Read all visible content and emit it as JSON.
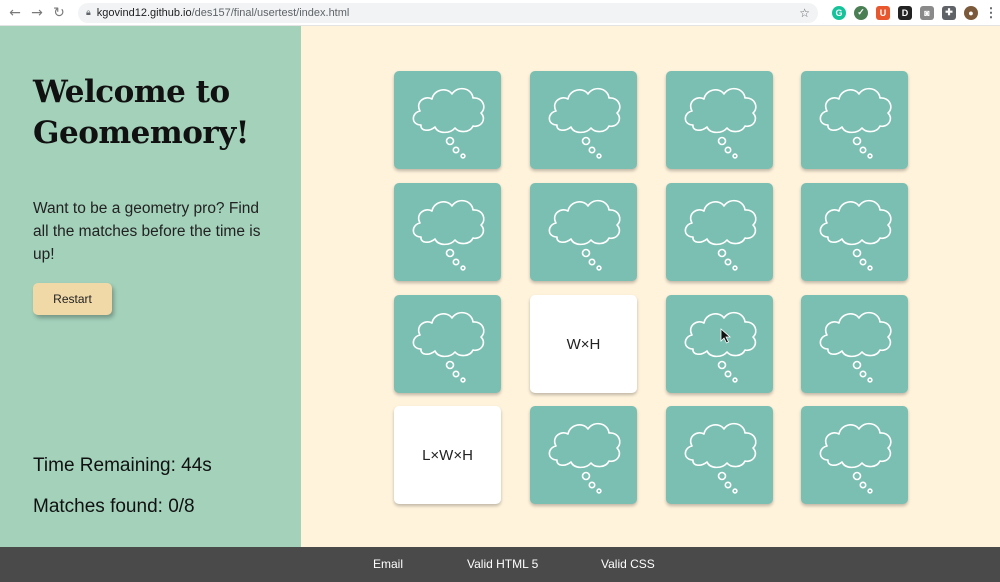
{
  "browser": {
    "url_host": "kgovind12.github.io",
    "url_path": "/des157/final/usertest/index.html",
    "extensions": [
      {
        "name": "grammarly",
        "letter": "G",
        "color": "#15c39a"
      },
      {
        "name": "check",
        "letter": "✓",
        "color": "#4a7f54"
      },
      {
        "name": "brave",
        "letter": "U",
        "color": "#e8572d"
      },
      {
        "name": "doc",
        "letter": "D",
        "color": "#222222"
      },
      {
        "name": "camera",
        "letter": "◙",
        "color": "#8a8a8a"
      },
      {
        "name": "puzzle",
        "letter": "✚",
        "color": "#5f6368"
      },
      {
        "name": "avatar",
        "letter": "●",
        "color": "#7a5a3a"
      }
    ]
  },
  "sidebar": {
    "title": "Welcome to Geomemory!",
    "intro": "Want to be a geometry pro? Find all the matches before the time is up!",
    "restart_label": "Restart",
    "time_remaining": "Time Remaining: 44s",
    "matches_found": "Matches found: 0/8"
  },
  "cards": [
    {
      "state": "back"
    },
    {
      "state": "back"
    },
    {
      "state": "back"
    },
    {
      "state": "back"
    },
    {
      "state": "back"
    },
    {
      "state": "back"
    },
    {
      "state": "back"
    },
    {
      "state": "back"
    },
    {
      "state": "back"
    },
    {
      "state": "face",
      "label": "W×H"
    },
    {
      "state": "back"
    },
    {
      "state": "back"
    },
    {
      "state": "face",
      "label": "L×W×H"
    },
    {
      "state": "back"
    },
    {
      "state": "back"
    },
    {
      "state": "back"
    }
  ],
  "footer": {
    "email": "Email",
    "html": "Valid HTML 5",
    "css": "Valid CSS"
  },
  "colors": {
    "sidebar_bg": "#a3d1ba",
    "page_bg": "#fff3dc",
    "card_back": "#7bbfb2",
    "card_face": "#ffffff",
    "restart_bg": "#f0d9a7",
    "footer_bg": "#4a4a4a"
  }
}
